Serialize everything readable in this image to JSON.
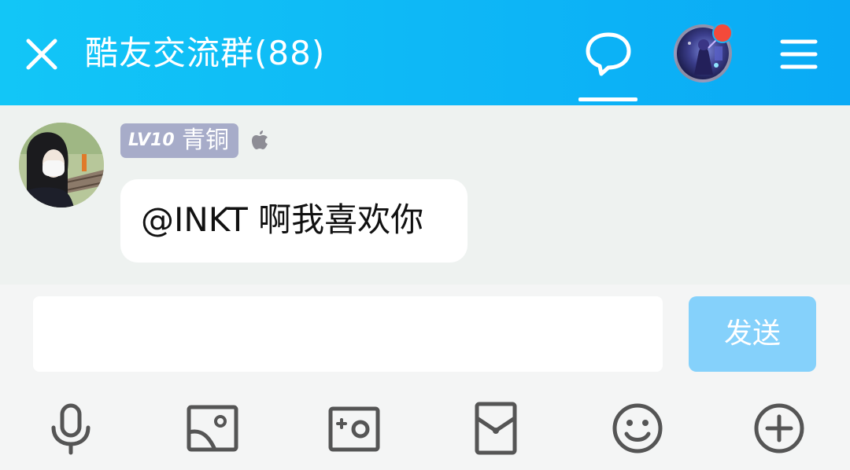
{
  "header": {
    "title": "酷友交流群(88)",
    "icons": [
      "close-icon",
      "chat-bubble-icon",
      "avatar",
      "menu-icon"
    ],
    "colors": {
      "gradient_start": "#12c6f7",
      "gradient_end": "#0aaaf5",
      "notification_dot": "#f44a3a"
    }
  },
  "message": {
    "level_tag": "LV10",
    "level_name": "青铜",
    "device_icon": "apple-icon",
    "text": "@INKT 啊我喜欢你"
  },
  "composer": {
    "input_value": "",
    "send_label": "发送",
    "send_color": "#85d1fb"
  },
  "toolbar": {
    "icons": [
      "microphone-icon",
      "image-icon",
      "camera-icon",
      "red-packet-icon",
      "emoji-icon",
      "plus-icon"
    ]
  }
}
